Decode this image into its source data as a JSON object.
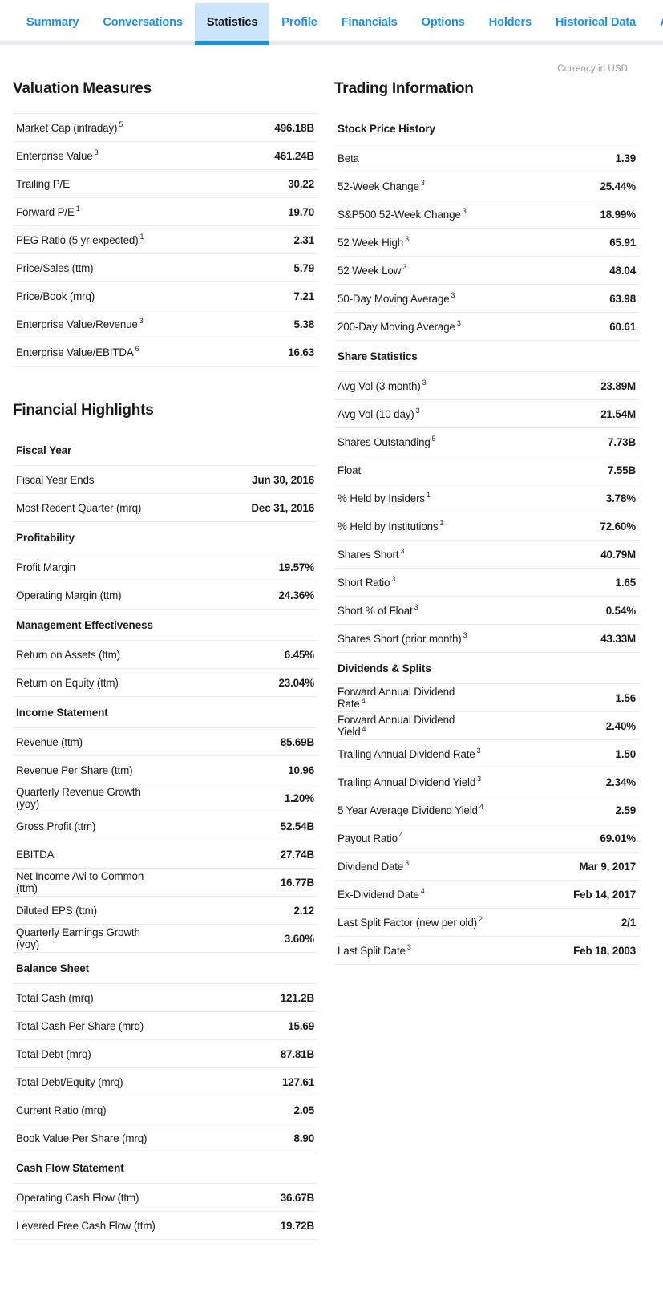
{
  "tabs": [
    {
      "label": "Summary",
      "active": false
    },
    {
      "label": "Conversations",
      "active": false
    },
    {
      "label": "Statistics",
      "active": true
    },
    {
      "label": "Profile",
      "active": false
    },
    {
      "label": "Financials",
      "active": false
    },
    {
      "label": "Options",
      "active": false
    },
    {
      "label": "Holders",
      "active": false
    },
    {
      "label": "Historical Data",
      "active": false
    },
    {
      "label": "Analysts",
      "active": false
    }
  ],
  "currency_note": "Currency in USD",
  "colors": {
    "tab_link": "#188fff",
    "tab_active_bg": "#cbe5fd",
    "tab_active_underline": "#0d8ff7",
    "divider": "#e8eaec",
    "tabbar_divider": "#e7e9ec",
    "text": "#1a1a1a",
    "muted": "#999a9e"
  },
  "left_column": {
    "title": "Valuation Measures",
    "sections": [
      {
        "heading": null,
        "rows": [
          {
            "label": "Market Cap (intraday)",
            "note": "5",
            "value": "496.18B"
          },
          {
            "label": "Enterprise Value",
            "note": "3",
            "value": "461.24B"
          },
          {
            "label": "Trailing P/E",
            "note": "",
            "value": "30.22"
          },
          {
            "label": "Forward P/E",
            "note": "1",
            "value": "19.70"
          },
          {
            "label": "PEG Ratio (5 yr expected)",
            "note": "1",
            "value": "2.31"
          },
          {
            "label": "Price/Sales (ttm)",
            "note": "",
            "value": "5.79"
          },
          {
            "label": "Price/Book (mrq)",
            "note": "",
            "value": "7.21"
          },
          {
            "label": "Enterprise Value/Revenue",
            "note": "3",
            "value": "5.38"
          },
          {
            "label": "Enterprise Value/EBITDA",
            "note": "6",
            "value": "16.63"
          }
        ]
      }
    ],
    "title2": "Financial Highlights",
    "sections2": [
      {
        "heading": "Fiscal Year",
        "rows": [
          {
            "label": "Fiscal Year Ends",
            "note": "",
            "value": "Jun 30, 2016"
          },
          {
            "label": "Most Recent Quarter (mrq)",
            "note": "",
            "value": "Dec 31, 2016"
          }
        ]
      },
      {
        "heading": "Profitability",
        "rows": [
          {
            "label": "Profit Margin",
            "note": "",
            "value": "19.57%"
          },
          {
            "label": "Operating Margin (ttm)",
            "note": "",
            "value": "24.36%"
          }
        ]
      },
      {
        "heading": "Management Effectiveness",
        "rows": [
          {
            "label": "Return on Assets (ttm)",
            "note": "",
            "value": "6.45%"
          },
          {
            "label": "Return on Equity (ttm)",
            "note": "",
            "value": "23.04%"
          }
        ]
      },
      {
        "heading": "Income Statement",
        "rows": [
          {
            "label": "Revenue (ttm)",
            "note": "",
            "value": "85.69B"
          },
          {
            "label": "Revenue Per Share (ttm)",
            "note": "",
            "value": "10.96"
          },
          {
            "label": "Quarterly Revenue Growth (yoy)",
            "note": "",
            "value": "1.20%"
          },
          {
            "label": "Gross Profit (ttm)",
            "note": "",
            "value": "52.54B"
          },
          {
            "label": "EBITDA",
            "note": "",
            "value": "27.74B"
          },
          {
            "label": "Net Income Avi to Common (ttm)",
            "note": "",
            "value": "16.77B"
          },
          {
            "label": "Diluted EPS (ttm)",
            "note": "",
            "value": "2.12"
          },
          {
            "label": "Quarterly Earnings Growth (yoy)",
            "note": "",
            "value": "3.60%"
          }
        ]
      },
      {
        "heading": "Balance Sheet",
        "rows": [
          {
            "label": "Total Cash (mrq)",
            "note": "",
            "value": "121.2B"
          },
          {
            "label": "Total Cash Per Share (mrq)",
            "note": "",
            "value": "15.69"
          },
          {
            "label": "Total Debt (mrq)",
            "note": "",
            "value": "87.81B"
          },
          {
            "label": "Total Debt/Equity (mrq)",
            "note": "",
            "value": "127.61"
          },
          {
            "label": "Current Ratio (mrq)",
            "note": "",
            "value": "2.05"
          },
          {
            "label": "Book Value Per Share (mrq)",
            "note": "",
            "value": "8.90"
          }
        ]
      },
      {
        "heading": "Cash Flow Statement",
        "rows": [
          {
            "label": "Operating Cash Flow (ttm)",
            "note": "",
            "value": "36.67B"
          },
          {
            "label": "Levered Free Cash Flow (ttm)",
            "note": "",
            "value": "19.72B"
          }
        ]
      }
    ]
  },
  "right_column": {
    "title": "Trading Information",
    "sections": [
      {
        "heading": "Stock Price History",
        "rows": [
          {
            "label": "Beta",
            "note": "",
            "value": "1.39"
          },
          {
            "label": "52-Week Change",
            "note": "3",
            "value": "25.44%"
          },
          {
            "label": "S&P500 52-Week Change",
            "note": "3",
            "value": "18.99%"
          },
          {
            "label": "52 Week High",
            "note": "3",
            "value": "65.91"
          },
          {
            "label": "52 Week Low",
            "note": "3",
            "value": "48.04"
          },
          {
            "label": "50-Day Moving Average",
            "note": "3",
            "value": "63.98"
          },
          {
            "label": "200-Day Moving Average",
            "note": "3",
            "value": "60.61"
          }
        ]
      },
      {
        "heading": "Share Statistics",
        "rows": [
          {
            "label": "Avg Vol (3 month)",
            "note": "3",
            "value": "23.89M"
          },
          {
            "label": "Avg Vol (10 day)",
            "note": "3",
            "value": "21.54M"
          },
          {
            "label": "Shares Outstanding",
            "note": "5",
            "value": "7.73B"
          },
          {
            "label": "Float",
            "note": "",
            "value": "7.55B"
          },
          {
            "label": "% Held by Insiders",
            "note": "1",
            "value": "3.78%"
          },
          {
            "label": "% Held by Institutions",
            "note": "1",
            "value": "72.60%"
          },
          {
            "label": "Shares Short",
            "note": "3",
            "value": "40.79M"
          },
          {
            "label": "Short Ratio",
            "note": "3",
            "value": "1.65"
          },
          {
            "label": "Short % of Float",
            "note": "3",
            "value": "0.54%"
          },
          {
            "label": "Shares Short (prior month)",
            "note": "3",
            "value": "43.33M"
          }
        ]
      },
      {
        "heading": "Dividends & Splits",
        "rows": [
          {
            "label": "Forward Annual Dividend Rate",
            "note": "4",
            "value": "1.56"
          },
          {
            "label": "Forward Annual Dividend Yield",
            "note": "4",
            "value": "2.40%"
          },
          {
            "label": "Trailing Annual Dividend Rate",
            "note": "3",
            "value": "1.50"
          },
          {
            "label": "Trailing Annual Dividend Yield",
            "note": "3",
            "value": "2.34%"
          },
          {
            "label": "5 Year Average Dividend Yield",
            "note": "4",
            "value": "2.59"
          },
          {
            "label": "Payout Ratio",
            "note": "4",
            "value": "69.01%"
          },
          {
            "label": "Dividend Date",
            "note": "3",
            "value": "Mar 9, 2017"
          },
          {
            "label": "Ex-Dividend Date",
            "note": "4",
            "value": "Feb 14, 2017"
          },
          {
            "label": "Last Split Factor (new per old)",
            "note": "2",
            "value": "2/1"
          },
          {
            "label": "Last Split Date",
            "note": "3",
            "value": "Feb 18, 2003"
          }
        ]
      }
    ]
  }
}
